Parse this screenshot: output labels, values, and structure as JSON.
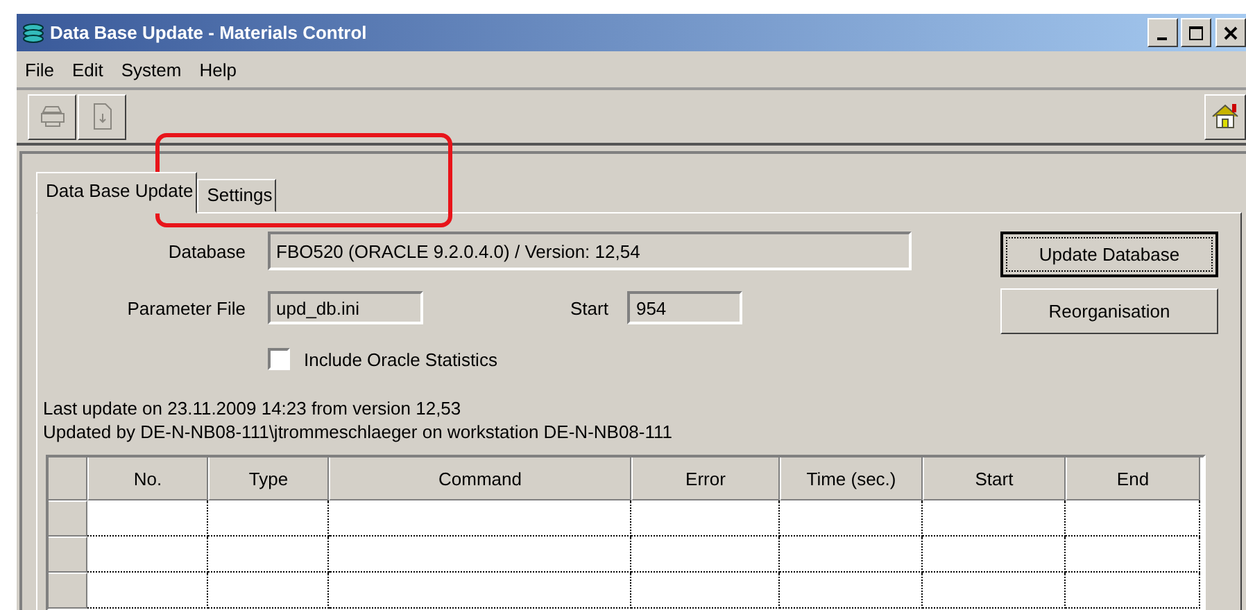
{
  "window": {
    "title": "Data Base Update - Materials Control"
  },
  "menu": [
    "File",
    "Edit",
    "System",
    "Help"
  ],
  "toolbar": [
    {
      "kind": "print",
      "disabled": true
    },
    {
      "kind": "document",
      "disabled": true
    },
    {
      "kind": "home",
      "disabled": false
    }
  ],
  "tabs": [
    {
      "label": "Data Base Update",
      "selected": true
    },
    {
      "label": "Settings",
      "selected": false
    }
  ],
  "form": {
    "database_label": "Database",
    "database_value": "FBO520 (ORACLE 9.2.0.4.0) / Version: 12,54",
    "parameter_label": "Parameter File",
    "parameter_value": "upd_db.ini",
    "start_label": "Start",
    "start_value": "954",
    "checkbox": {
      "label": "Include Oracle Statistics",
      "checked": false
    }
  },
  "buttons": [
    {
      "label": "Update Database",
      "default": true
    },
    {
      "label": "Reorganisation",
      "default": false
    }
  ],
  "status_lines": [
    "Last update on 23.11.2009 14:23 from version 12,53",
    "Updated by DE-N-NB08-111\\jtrommeschlaeger on workstation DE-N-NB08-111"
  ],
  "table": {
    "columns": [
      "No.",
      "Type",
      "Command",
      "Error",
      "Time (sec.)",
      "Start",
      "End"
    ]
  },
  "annotations": [
    {
      "kind": "rectangle"
    }
  ]
}
